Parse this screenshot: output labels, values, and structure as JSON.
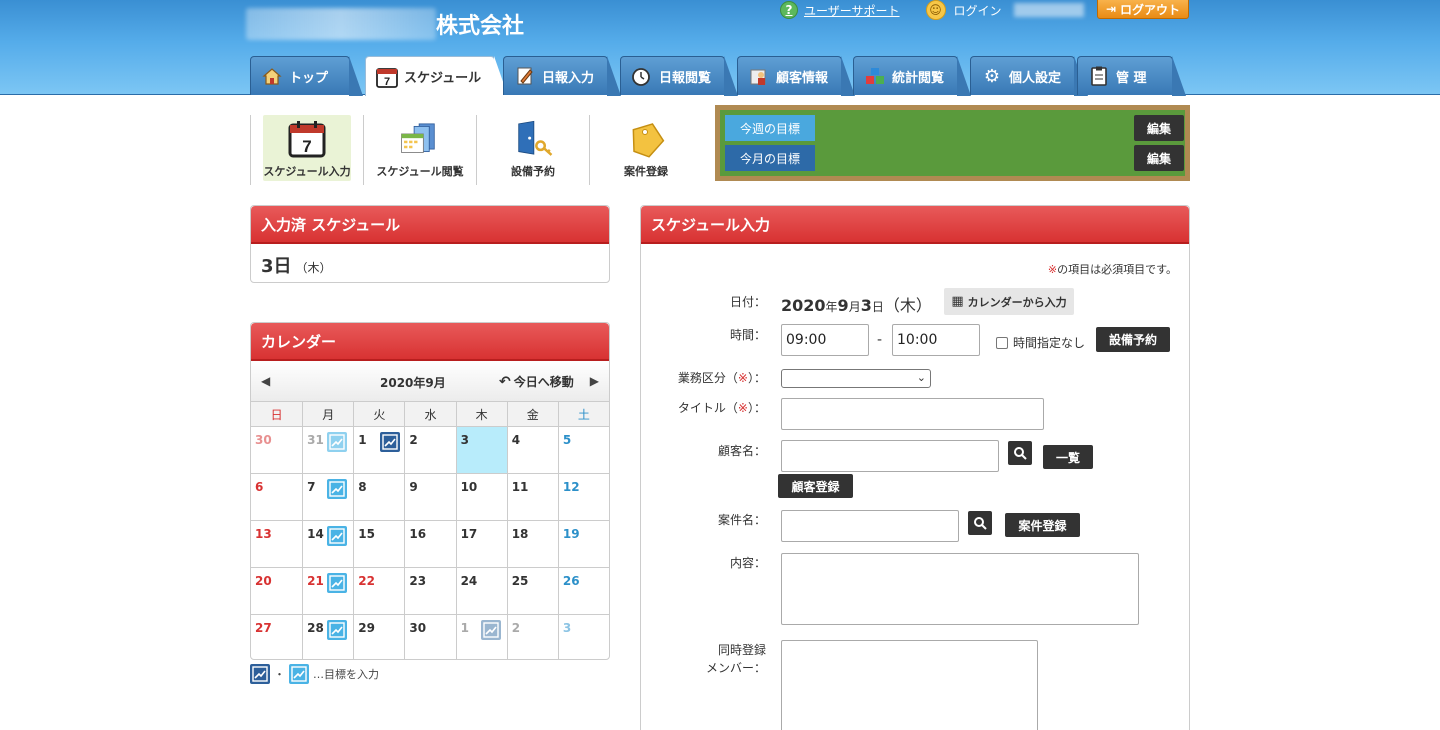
{
  "header": {
    "company_suffix": "株式会社",
    "support_label": "ユーザーサポート",
    "login_label": "ログイン",
    "logout_label": "ログアウト"
  },
  "tabs": [
    {
      "label": "トップ",
      "icon": "home-icon"
    },
    {
      "label": "スケジュール",
      "icon": "calendar-icon",
      "active": true
    },
    {
      "label": "日報入力",
      "icon": "pencil-note-icon"
    },
    {
      "label": "日報閲覧",
      "icon": "clock-icon"
    },
    {
      "label": "顧客情報",
      "icon": "customer-icon"
    },
    {
      "label": "統計閲覧",
      "icon": "stats-blocks-icon"
    },
    {
      "label": "個人設定",
      "icon": "gear-icon"
    },
    {
      "label": "管 理",
      "icon": "clipboard-icon"
    }
  ],
  "subnav": [
    {
      "label": "スケジュール入力",
      "icon": "calendar-7-icon",
      "active": true
    },
    {
      "label": "スケジュール閲覧",
      "icon": "schedule-view-icon"
    },
    {
      "label": "設備予約",
      "icon": "door-key-icon"
    },
    {
      "label": "案件登録",
      "icon": "tag-icon"
    }
  ],
  "goals": {
    "week_label": "今週の目標",
    "month_label": "今月の目標",
    "edit_label": "編集"
  },
  "entered": {
    "title": "入力済 スケジュール",
    "day_num": "3日",
    "weekday": "（木）"
  },
  "calendar": {
    "title": "カレンダー",
    "month_label": "2020年9月",
    "today_label": "今日へ移動",
    "prev": "◀",
    "next": "▶",
    "weekdays": [
      "日",
      "月",
      "火",
      "水",
      "木",
      "金",
      "土"
    ],
    "legend_sep": "・",
    "legend_text": "…目標を入力"
  },
  "form": {
    "title": "スケジュール入力",
    "required_note_mark": "※",
    "required_note": "の項目は必須項目です。",
    "date_label": "日付：",
    "date_year": "2020",
    "date_y": "年",
    "date_month": "9",
    "date_m": "月",
    "date_day": "3",
    "date_d": "日",
    "date_weekday": "（木）",
    "calendar_input_label": "カレンダーから入力",
    "time_label": "時間：",
    "time_start": "09:00",
    "time_dash": "-",
    "time_end": "10:00",
    "no_time_label": "時間指定なし",
    "facility_btn": "設備予約",
    "category_label_a": "業務区分（",
    "category_label_b": "）：",
    "title_label_a": "タイトル（",
    "title_label_b": "）：",
    "mark": "※",
    "customer_label": "顧客名：",
    "list_btn": "一覧",
    "customer_reg_btn": "顧客登録",
    "project_label": "案件名：",
    "project_reg_btn": "案件登録",
    "content_label": "内容：",
    "members_label_1": "同時登録",
    "members_label_2": "メンバー："
  },
  "colors": {
    "header_blue": "#55acea",
    "panel_red": "#d83232",
    "goal_board_green": "#5a9a3c",
    "today_cell": "#b8ecfb"
  }
}
